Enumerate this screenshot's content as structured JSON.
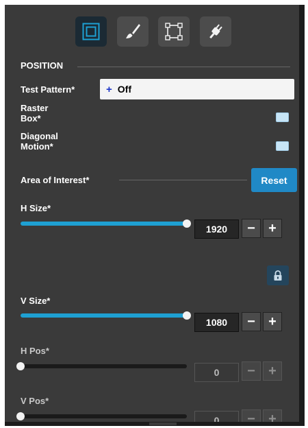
{
  "toolbar": {
    "tools": [
      {
        "name": "position",
        "icon": "frame-square-icon",
        "active": true
      },
      {
        "name": "paint",
        "icon": "paintbrush-icon",
        "active": false
      },
      {
        "name": "transform",
        "icon": "crop-handles-icon",
        "active": false
      },
      {
        "name": "plugin",
        "icon": "power-plug-icon",
        "active": false
      }
    ]
  },
  "position": {
    "section_title": "POSITION",
    "test_pattern": {
      "label": "Test Pattern*",
      "plus": "+",
      "value": "Off"
    },
    "raster_box": {
      "label_line1": "Raster",
      "label_line2": "Box*"
    },
    "diagonal_motion": {
      "label_line1": "Diagonal",
      "label_line2": "Motion*"
    },
    "area_of_interest": {
      "label": "Area of Interest*",
      "reset_label": "Reset"
    },
    "h_size": {
      "label": "H Size*",
      "value": "1920",
      "fraction": 1.0
    },
    "v_size": {
      "label": "V Size*",
      "value": "1080",
      "fraction": 1.0
    },
    "h_pos": {
      "label": "H Pos*",
      "value": "0",
      "fraction": 0.0
    },
    "v_pos": {
      "label": "V Pos*",
      "value": "0",
      "fraction": 0.0
    },
    "minus_label": "−",
    "plus_label": "+"
  },
  "colors": {
    "accent": "#2089c6",
    "slider_fill": "#1ea0d2",
    "panel_bg": "#3a3a3a"
  }
}
